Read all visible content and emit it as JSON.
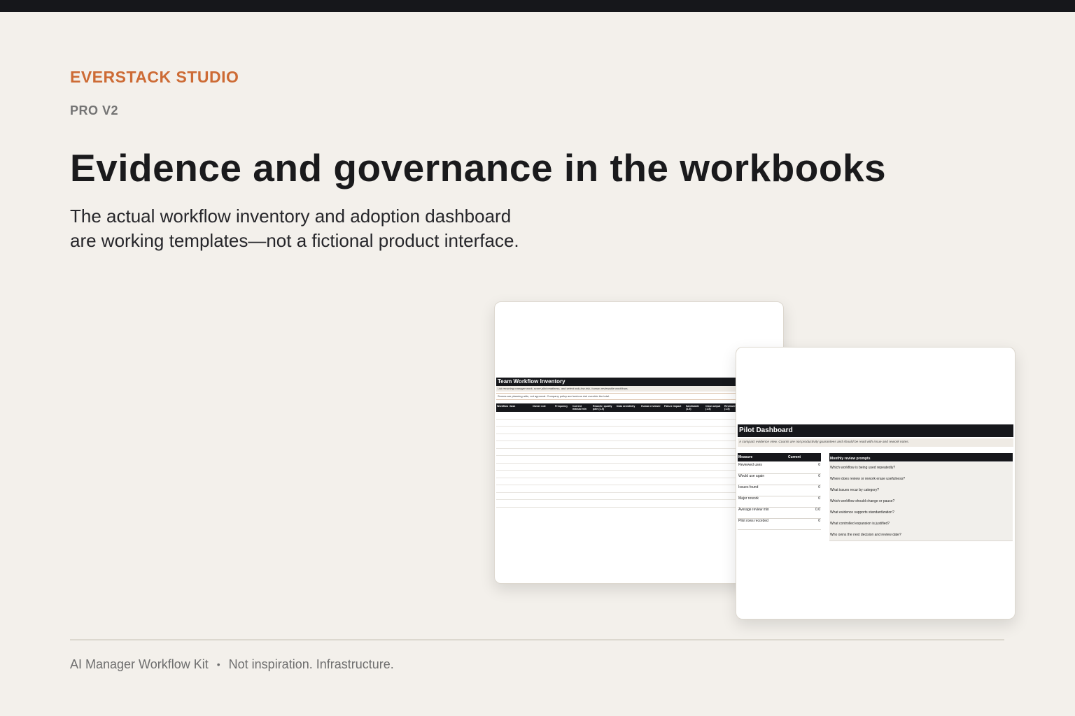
{
  "brand": "EVERSTACK STUDIO",
  "edition": "PRO V2",
  "headline": "Evidence and governance in the workbooks",
  "subhead_line1": "The actual workflow inventory and adoption dashboard",
  "subhead_line2": "are working templates—not a fictional product interface.",
  "inventory": {
    "title": "Team Workflow Inventory",
    "note": "List recurring manager work, score pilot readiness, and select only low-risk, human-reviewable workflows.",
    "note2": "Scores are planning aids, not approval. Company policy and serious risk override the total.",
    "columns": [
      "Workflow / task",
      "Owner role",
      "Frequency",
      "Current manual min",
      "Rework / quality pain (1-5)",
      "Data sensitivity",
      "Human reviewer",
      "Failure impact",
      "Sanitizable (1-5)",
      "Clear output (1-5)",
      "Reviewer (1-5)"
    ]
  },
  "dashboard": {
    "title": "Pilot Dashboard",
    "note": "A compact evidence view. Counts are not productivity guarantees and should be read with issue and rework notes.",
    "measure_header": "Measure",
    "current_header": "Current",
    "measures": [
      {
        "label": "Reviewed uses",
        "value": "0"
      },
      {
        "label": "Would use again",
        "value": "0"
      },
      {
        "label": "Issues found",
        "value": "0"
      },
      {
        "label": "Major rework",
        "value": "0"
      },
      {
        "label": "Average review min",
        "value": "0.0"
      },
      {
        "label": "Pilot rows recorded",
        "value": "0"
      }
    ],
    "prompts_header": "Monthly review prompts",
    "prompts": [
      "Which workflow is being used repeatedly?",
      "Where does review or rework erase usefulness?",
      "What issues recur by category?",
      "Which workflow should change or pause?",
      "What evidence supports standardization?",
      "What controlled expansion is justified?",
      "Who owns the next decision and review date?"
    ]
  },
  "footer": {
    "product": "AI Manager Workflow Kit",
    "separator": "•",
    "tagline": "Not inspiration. Infrastructure."
  }
}
